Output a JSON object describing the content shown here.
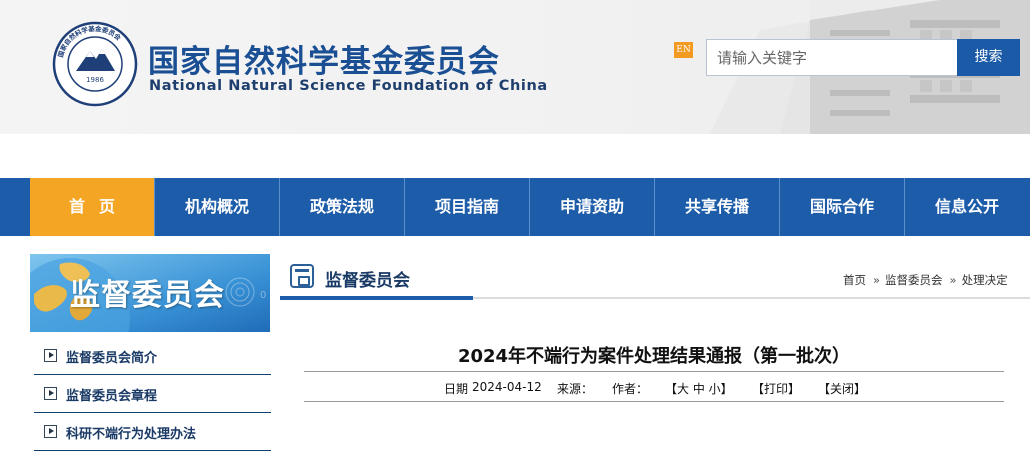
{
  "header": {
    "org_name_cn": "国家自然科学基金委员会",
    "org_name_en": "National Natural Science Foundation of China",
    "logo_year": "1986",
    "logo_ring_text": "国家自然科学基金委员会",
    "en_button": "EN",
    "search_placeholder": "请输入关键字",
    "search_button": "搜索"
  },
  "nav": {
    "items": [
      {
        "label": "首页",
        "active": true
      },
      {
        "label": "机构概况"
      },
      {
        "label": "政策法规"
      },
      {
        "label": "项目指南"
      },
      {
        "label": "申请资助"
      },
      {
        "label": "共享传播"
      },
      {
        "label": "国际合作"
      },
      {
        "label": "信息公开"
      }
    ]
  },
  "sidebar": {
    "banner_title": "监督委员会",
    "items": [
      {
        "label": "监督委员会简介"
      },
      {
        "label": "监督委员会章程"
      },
      {
        "label": "科研不端行为处理办法"
      }
    ]
  },
  "main": {
    "section_title": "监督委员会",
    "breadcrumb": [
      "首页",
      "监督委员会",
      "处理决定"
    ],
    "breadcrumb_sep": "»",
    "article": {
      "title": "2024年不端行为案件处理结果通报（第一批次）",
      "date_label": "日期",
      "date": "2024-04-12",
      "source_label": "来源：",
      "author_label": "作者：",
      "font_size_controls": "【大 中 小】",
      "print": "【打印】",
      "close": "【关闭】"
    }
  },
  "colors": {
    "brand_blue": "#1d5ca8",
    "nav_active": "#f5a524",
    "en_orange": "#f39a20"
  }
}
